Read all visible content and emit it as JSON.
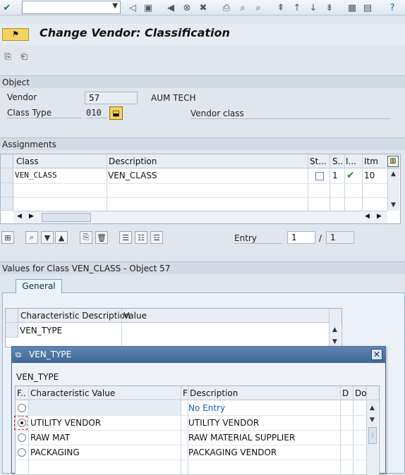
{
  "toolbar": {
    "command_field_value": "",
    "icons": [
      "enter-icon",
      "back-icon",
      "save-icon",
      "exit-icon",
      "cancel-icon",
      "print-icon",
      "find-icon",
      "find-next-icon",
      "first-page-icon",
      "previous-page-icon",
      "next-page-icon",
      "last-page-icon",
      "new-session-icon",
      "shortcut-icon",
      "help-icon"
    ]
  },
  "title": "Change Vendor: Classification",
  "object_section": {
    "header": "Object",
    "vendor_label": "Vendor",
    "vendor_value": "57",
    "vendor_name": "AUM TECH",
    "class_type_label": "Class Type",
    "class_type_value": "010",
    "class_type_desc": "Vendor class"
  },
  "assignments": {
    "header": "Assignments",
    "columns": [
      "Class",
      "Description",
      "St...",
      "S..",
      "I...",
      "Itm"
    ],
    "rows": [
      {
        "class": "VEN_CLASS",
        "description": "VEN_CLASS",
        "status_checked": false,
        "s": "1",
        "i": "check",
        "itm": "10"
      }
    ],
    "entry_label": "Entry",
    "entry_value": "1",
    "entry_separator": "/",
    "entry_total": "1"
  },
  "values": {
    "header": "Values for Class VEN_CLASS - Object 57",
    "tab_label": "General",
    "columns": [
      "Characteristic Description",
      "Value"
    ],
    "rows": [
      {
        "desc": "VEN_TYPE",
        "value": ""
      }
    ]
  },
  "popup": {
    "title": "VEN_TYPE",
    "subtitle": "VEN_TYPE",
    "columns": [
      "F..",
      "Characteristic Value",
      "F",
      "Description",
      "D",
      "Do"
    ],
    "rows": [
      {
        "selected": false,
        "value": "",
        "description": "No Entry"
      },
      {
        "selected": true,
        "value": "UTILITY VENDOR",
        "description": "UTILITY VENDOR"
      },
      {
        "selected": false,
        "value": "RAW MAT",
        "description": "RAW MATERIAL SUPPLIER"
      },
      {
        "selected": false,
        "value": "PACKAGING",
        "description": "PACKAGING VENDOR"
      }
    ],
    "colors": {
      "no_entry": "#1a5fb4",
      "title_bar": "#3f6896"
    }
  }
}
